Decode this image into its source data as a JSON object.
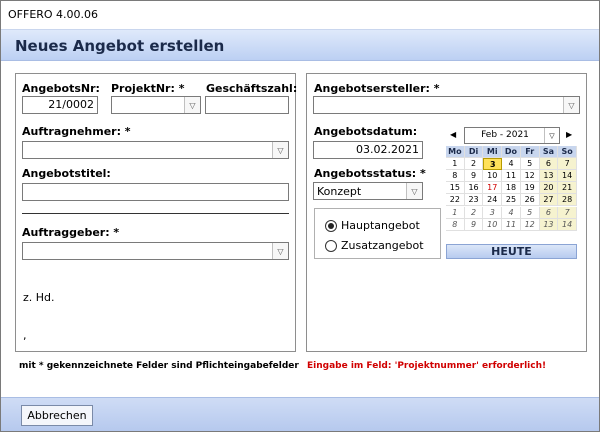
{
  "app": {
    "title": "OFFERO 4.00.06"
  },
  "dialog": {
    "heading": "Neues Angebot erstellen"
  },
  "left": {
    "angebotsnr": {
      "label": "AngebotsNr:",
      "value": "21/0002"
    },
    "projektnr": {
      "label": "ProjektNr: *",
      "value": ""
    },
    "geschaeftszahl": {
      "label": "Geschäftszahl:",
      "value": ""
    },
    "auftragnehmer": {
      "label": "Auftragnehmer: *",
      "value": ""
    },
    "angebotstitel": {
      "label": "Angebotstitel:",
      "value": ""
    },
    "auftraggeber": {
      "label": "Auftraggeber: *",
      "value": ""
    },
    "zhd": "z. Hd.",
    "comma": ","
  },
  "right": {
    "ersteller": {
      "label": "Angebotsersteller: *",
      "value": ""
    },
    "datum": {
      "label": "Angebotsdatum:",
      "value": "03.02.2021"
    },
    "status": {
      "label": "Angebotsstatus: *",
      "value": "Konzept"
    },
    "radios": [
      {
        "label": "Hauptangebot",
        "checked": true
      },
      {
        "label": "Zusatzangebot",
        "checked": false
      }
    ]
  },
  "calendar": {
    "month": "Feb - 2021",
    "prev_glyph": "◀",
    "next_glyph": "▶",
    "weekdays": [
      "Mo",
      "Di",
      "Mi",
      "Do",
      "Fr",
      "Sa",
      "So"
    ],
    "weeks": [
      [
        "1",
        "2",
        "3",
        "4",
        "5",
        "6",
        "7"
      ],
      [
        "8",
        "9",
        "10",
        "11",
        "12",
        "13",
        "14"
      ],
      [
        "15",
        "16",
        "17",
        "18",
        "19",
        "20",
        "21"
      ],
      [
        "22",
        "23",
        "24",
        "25",
        "26",
        "27",
        "28"
      ],
      [
        "1",
        "2",
        "3",
        "4",
        "5",
        "6",
        "7"
      ],
      [
        "8",
        "9",
        "10",
        "11",
        "12",
        "13",
        "14"
      ]
    ],
    "today_button": "HEUTE",
    "selected_day": "3",
    "highlight_day": "17"
  },
  "notes": {
    "mandatory": "mit * gekennzeichnete Felder sind Pflichteingabefelder",
    "error": "Eingabe im Feld: 'Projektnummer' erforderlich!"
  },
  "footer": {
    "cancel": "Abbrechen"
  },
  "colors": {
    "header": "#bcd0f3",
    "error": "#d00000",
    "today": "#ffe15a",
    "weekend": "#f6f3cf"
  }
}
